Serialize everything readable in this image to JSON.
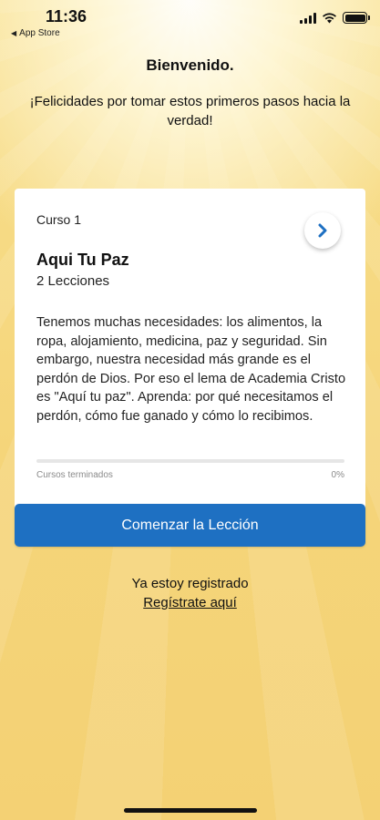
{
  "status_bar": {
    "time": "11:36",
    "back_app": "App Store",
    "signal_icon": "cellular-signal-icon",
    "wifi_icon": "wifi-icon",
    "battery_icon": "battery-icon"
  },
  "header": {
    "title": "Bienvenido.",
    "subtitle": "¡Felicidades por tomar estos primeros pasos hacia la verdad!"
  },
  "course_card": {
    "course_number": "Curso 1",
    "title": "Aqui Tu Paz",
    "lessons": "2 Lecciones",
    "description": "Tenemos muchas necesidades: los alimentos, la ropa, alojamiento, medicina, paz y seguridad. Sin embargo, nuestra necesidad más grande es el perdón de Dios. Por eso el lema de Academia Cristo es \"Aquí tu paz\". Aprenda: por qué necesitamos el perdón, cómo fue ganado y cómo lo recibimos.",
    "progress_label": "Cursos terminados",
    "progress_value": "0%",
    "progress_fraction": 0,
    "next_icon": "chevron-right-icon"
  },
  "actions": {
    "start_button": "Comenzar la Lección",
    "already_registered": "Ya estoy registrado",
    "register_link": "Regístrate aquí"
  },
  "colors": {
    "accent_blue": "#1e70c2",
    "background_yellow": "#f6d77e"
  }
}
